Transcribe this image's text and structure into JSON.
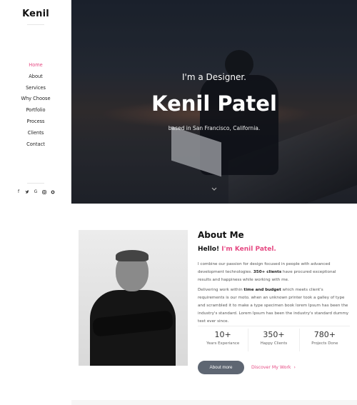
{
  "sidebar": {
    "brand": "Kenil",
    "nav": [
      {
        "label": "Home",
        "active": true
      },
      {
        "label": "About",
        "active": false
      },
      {
        "label": "Services",
        "active": false
      },
      {
        "label": "Why Choose",
        "active": false
      },
      {
        "label": "Portfolio",
        "active": false
      },
      {
        "label": "Process",
        "active": false
      },
      {
        "label": "Clients",
        "active": false
      },
      {
        "label": "Contact",
        "active": false
      }
    ],
    "social": [
      "facebook-icon",
      "twitter-icon",
      "google-icon",
      "instagram-icon",
      "github-icon"
    ]
  },
  "hero": {
    "pre": "I'm a Designer.",
    "name": "Kenil Patel",
    "sub": "based in San Francisco, California."
  },
  "about": {
    "title": "About Me",
    "hello": "Hello!",
    "hello_name": "I'm Kenil Patel.",
    "p1_a": "I combine our passion for design focused in people with advanced development technologies.",
    "p1_b": "350+ clients",
    "p1_c": "have procured exceptional results and happiness while working with me.",
    "p2_a": "Delivering work within",
    "p2_b": "time and budget",
    "p2_c": "which meets client's requirements is our moto. when an unknown printer took a galley of type and scrambled it to make a type specimen book lorem Ipsum has been the industry's standard. Lorem Ipsum has been the industry's standard dummy text ever since.",
    "stats": [
      {
        "num": "10+",
        "label": "Years Experiance"
      },
      {
        "num": "350+",
        "label": "Happy Clients"
      },
      {
        "num": "780+",
        "label": "Projects Done"
      }
    ],
    "btn_more": "About more",
    "link_discover": "Discover My Work"
  },
  "colors": {
    "accent": "#e64a83",
    "button": "#5e6672"
  }
}
